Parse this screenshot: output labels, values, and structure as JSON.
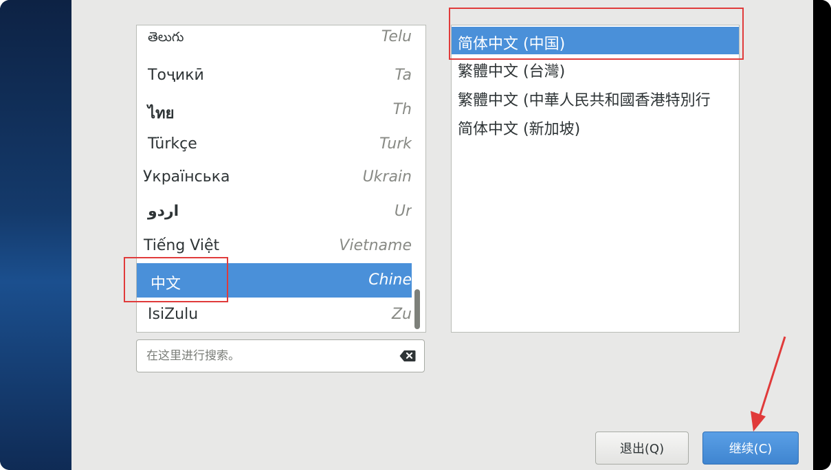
{
  "top_hint": "",
  "language_list": {
    "items": [
      {
        "native": "తెలుగు",
        "english": "Telu"
      },
      {
        "native": "Тоҷикӣ",
        "english": "Ta"
      },
      {
        "native": "ไทย",
        "english": "Th"
      },
      {
        "native": "Türkçe",
        "english": "Turk"
      },
      {
        "native": "Українська",
        "english": "Ukrain"
      },
      {
        "native": "اردو",
        "english": "Ur"
      },
      {
        "native": "Tiếng Việt",
        "english": "Vietname"
      },
      {
        "native": "中文",
        "english": "Chine",
        "selected": true
      },
      {
        "native": "IsiZulu",
        "english": "Zu"
      }
    ]
  },
  "search": {
    "placeholder": "在这里进行搜索。",
    "clear_icon": "clear-backspace-icon"
  },
  "locale_list": {
    "items": [
      {
        "label": "简体中文 (中国)",
        "selected": true
      },
      {
        "label": "繁體中文 (台灣)"
      },
      {
        "label": "繁體中文 (中華人民共和國香港特別行"
      },
      {
        "label": "简体中文 (新加坡)"
      }
    ]
  },
  "buttons": {
    "quit_label": "退出(Q)",
    "continue_label": "继续(C)"
  },
  "colors": {
    "selection": "#4a90d9",
    "annotation": "#e03a3a"
  }
}
